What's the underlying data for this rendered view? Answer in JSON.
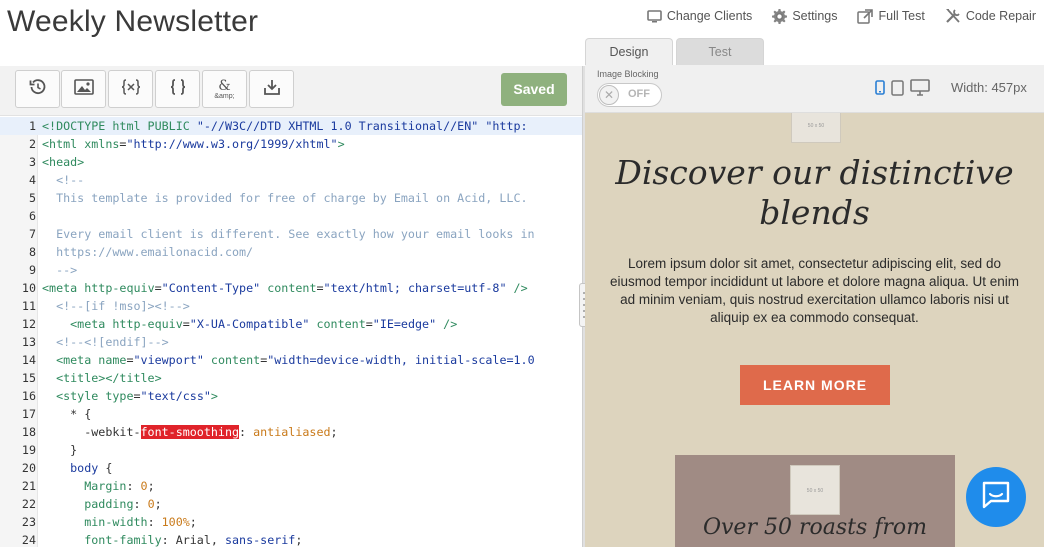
{
  "header": {
    "title": "Weekly Newsletter",
    "actions": [
      {
        "label": "Change Clients",
        "icon": "monitor-icon"
      },
      {
        "label": "Settings",
        "icon": "gear-icon"
      },
      {
        "label": "Full Test",
        "icon": "external-link-icon"
      },
      {
        "label": "Code Repair",
        "icon": "tools-icon"
      }
    ]
  },
  "tabs": [
    {
      "label": "Design",
      "active": true
    },
    {
      "label": "Test",
      "active": false
    }
  ],
  "toolbar": {
    "buttons": [
      "history-icon",
      "image-icon",
      "braces-x-icon",
      "braces-icon",
      "entity-icon",
      "download-icon"
    ],
    "entity_label": "&amp;",
    "saved_label": "Saved"
  },
  "code_lines": [
    {
      "n": "1",
      "tokens": [
        [
          "t-tag",
          "<!DOCTYPE html PUBLIC "
        ],
        [
          "t-str",
          "\"-//W3C//DTD XHTML 1.0 Transitional//EN\""
        ],
        [
          "t-plain",
          " "
        ],
        [
          "t-str",
          "\"http:"
        ]
      ]
    },
    {
      "n": "2",
      "tokens": [
        [
          "t-tag",
          "<html "
        ],
        [
          "t-attr",
          "xmlns"
        ],
        [
          "t-plain",
          "="
        ],
        [
          "t-str",
          "\"http://www.w3.org/1999/xhtml\""
        ],
        [
          "t-tag",
          ">"
        ]
      ]
    },
    {
      "n": "3",
      "tokens": [
        [
          "t-tag",
          "<head>"
        ]
      ]
    },
    {
      "n": "4",
      "tokens": [
        [
          "t-com",
          "  <!--"
        ]
      ]
    },
    {
      "n": "5",
      "tokens": [
        [
          "t-com",
          "  This template is provided for free of charge by Email on Acid, LLC."
        ]
      ]
    },
    {
      "n": "6",
      "tokens": [
        [
          "t-com",
          " "
        ]
      ]
    },
    {
      "n": "7",
      "tokens": [
        [
          "t-com",
          "  Every email client is different. See exactly how your email looks in"
        ]
      ]
    },
    {
      "n": "8",
      "tokens": [
        [
          "t-com",
          "  https://www.emailonacid.com/"
        ]
      ]
    },
    {
      "n": "9",
      "tokens": [
        [
          "t-com",
          "  -->"
        ]
      ]
    },
    {
      "n": "10",
      "tokens": [
        [
          "t-tag",
          "<meta "
        ],
        [
          "t-attr",
          "http-equiv"
        ],
        [
          "t-plain",
          "="
        ],
        [
          "t-str",
          "\"Content-Type\""
        ],
        [
          "t-plain",
          " "
        ],
        [
          "t-attr",
          "content"
        ],
        [
          "t-plain",
          "="
        ],
        [
          "t-str",
          "\"text/html; charset=utf-8\""
        ],
        [
          "t-plain",
          " "
        ],
        [
          "t-tag",
          "/>"
        ]
      ]
    },
    {
      "n": "11",
      "tokens": [
        [
          "t-com",
          "  <!--[if !mso]><!-->"
        ]
      ]
    },
    {
      "n": "12",
      "tokens": [
        [
          "t-tag",
          "    <meta "
        ],
        [
          "t-attr",
          "http-equiv"
        ],
        [
          "t-plain",
          "="
        ],
        [
          "t-str",
          "\"X-UA-Compatible\""
        ],
        [
          "t-plain",
          " "
        ],
        [
          "t-attr",
          "content"
        ],
        [
          "t-plain",
          "="
        ],
        [
          "t-str",
          "\"IE=edge\""
        ],
        [
          "t-plain",
          " "
        ],
        [
          "t-tag",
          "/>"
        ]
      ]
    },
    {
      "n": "13",
      "tokens": [
        [
          "t-com",
          "  <!--<![endif]-->"
        ]
      ]
    },
    {
      "n": "14",
      "tokens": [
        [
          "t-tag",
          "  <meta "
        ],
        [
          "t-attr",
          "name"
        ],
        [
          "t-plain",
          "="
        ],
        [
          "t-str",
          "\"viewport\""
        ],
        [
          "t-plain",
          " "
        ],
        [
          "t-attr",
          "content"
        ],
        [
          "t-plain",
          "="
        ],
        [
          "t-str",
          "\"width=device-width, initial-scale=1.0"
        ]
      ]
    },
    {
      "n": "15",
      "tokens": [
        [
          "t-tag",
          "  <title></title>"
        ]
      ]
    },
    {
      "n": "16",
      "tokens": [
        [
          "t-tag",
          "  <style "
        ],
        [
          "t-attr",
          "type"
        ],
        [
          "t-plain",
          "="
        ],
        [
          "t-str",
          "\"text/css\""
        ],
        [
          "t-tag",
          ">"
        ]
      ]
    },
    {
      "n": "17",
      "tokens": [
        [
          "t-sel",
          "    * {"
        ]
      ]
    },
    {
      "n": "18",
      "tokens": [
        [
          "t-plain",
          "      -webkit-"
        ],
        [
          "t-hl",
          "font-smoothing"
        ],
        [
          "t-plain",
          ": "
        ],
        [
          "t-val",
          "antialiased"
        ],
        [
          "t-plain",
          ";"
        ]
      ]
    },
    {
      "n": "19",
      "tokens": [
        [
          "t-plain",
          "    }"
        ]
      ]
    },
    {
      "n": "20",
      "tokens": [
        [
          "t-kw",
          "    body"
        ],
        [
          "t-plain",
          " {"
        ]
      ]
    },
    {
      "n": "21",
      "tokens": [
        [
          "t-prop",
          "      Margin"
        ],
        [
          "t-plain",
          ": "
        ],
        [
          "t-num",
          "0"
        ],
        [
          "t-plain",
          ";"
        ]
      ]
    },
    {
      "n": "22",
      "tokens": [
        [
          "t-prop",
          "      padding"
        ],
        [
          "t-plain",
          ": "
        ],
        [
          "t-num",
          "0"
        ],
        [
          "t-plain",
          ";"
        ]
      ]
    },
    {
      "n": "23",
      "tokens": [
        [
          "t-prop",
          "      min-width"
        ],
        [
          "t-plain",
          ": "
        ],
        [
          "t-num",
          "100%"
        ],
        [
          "t-plain",
          ";"
        ]
      ]
    },
    {
      "n": "24",
      "tokens": [
        [
          "t-prop",
          "      font-family"
        ],
        [
          "t-plain",
          ": Arial, "
        ],
        [
          "t-str",
          "sans-serif"
        ],
        [
          "t-plain",
          ";"
        ]
      ]
    }
  ],
  "preview_header": {
    "image_blocking_label": "Image Blocking",
    "toggle_label": "OFF",
    "devices": [
      "mobile-icon",
      "tablet-icon",
      "desktop-icon"
    ],
    "width_label": "Width: 457px"
  },
  "preview": {
    "placeholder_label": "50 x 50",
    "headline": "Discover our distinctive blends",
    "body": "Lorem ipsum dolor sit amet, consectetur adipiscing elit, sed do eiusmod tempor incididunt ut labore et dolore magna aliqua. Ut enim ad minim veniam, quis nostrud exercitation ullamco laboris nisi ut aliquip ex ea commodo consequat.",
    "cta": "LEARN MORE",
    "card_placeholder": "50 x 50",
    "card_headline": "Over 50 roasts from"
  },
  "chat": {
    "icon": "chat-icon"
  },
  "colors": {
    "saved": "#8fb17e",
    "cta": "#df6a4b",
    "preview_bg": "#ddd4be",
    "chat": "#1f8ceb"
  }
}
